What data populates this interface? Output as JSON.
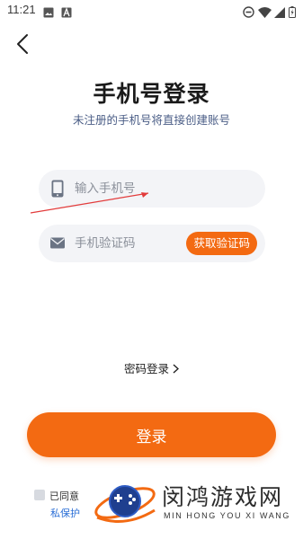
{
  "status_bar": {
    "time": "11:21"
  },
  "header": {
    "title": "手机号登录",
    "subtitle": "未注册的手机号将直接创建账号"
  },
  "phone_field": {
    "placeholder": "输入手机号",
    "value": "",
    "icon": "phone-icon"
  },
  "code_field": {
    "placeholder": "手机验证码",
    "value": "",
    "icon": "mail-icon",
    "get_code_label": "获取验证码"
  },
  "password_login_label": "密码登录",
  "login_button_label": "登录",
  "agreement": {
    "checked": false,
    "text_visible": "已同意",
    "privacy_link_visible": "私保护"
  },
  "watermark": {
    "title": "闵鸿游戏网",
    "subtitle": "MIN HONG YOU XI WANG"
  },
  "colors": {
    "accent": "#f36a12",
    "field_bg": "#f3f4f7",
    "subtitle": "#4a5d86",
    "link": "#2b6fd6",
    "annotation": "#e23b3b"
  }
}
